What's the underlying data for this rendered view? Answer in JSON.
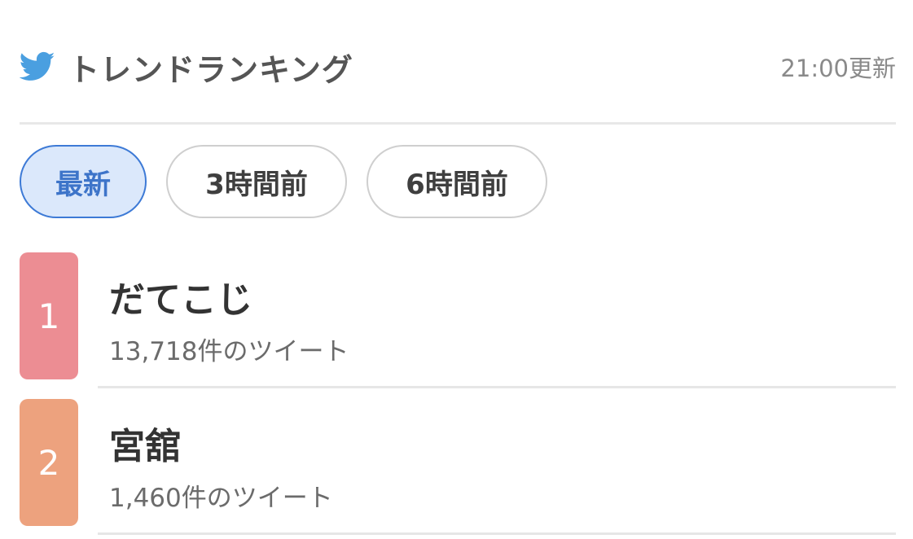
{
  "header": {
    "title": "トレンドランキング",
    "updated": "21:00更新",
    "icon": "twitter-bird-icon",
    "icon_color": "#4a9fe0"
  },
  "tabs": [
    {
      "label": "最新",
      "active": true
    },
    {
      "label": "3時間前",
      "active": false
    },
    {
      "label": "6時間前",
      "active": false
    }
  ],
  "colors": {
    "active_tab_bg": "#dbe8fb",
    "active_tab_border": "#3d7ad6",
    "rank_1": "#ec8d93",
    "rank_2": "#eda27e"
  },
  "trends": [
    {
      "rank": "1",
      "name": "だてこじ",
      "count": "13,718件のツイート",
      "color": "#ec8d93"
    },
    {
      "rank": "2",
      "name": "宮舘",
      "count": "1,460件のツイート",
      "color": "#eda27e"
    }
  ]
}
